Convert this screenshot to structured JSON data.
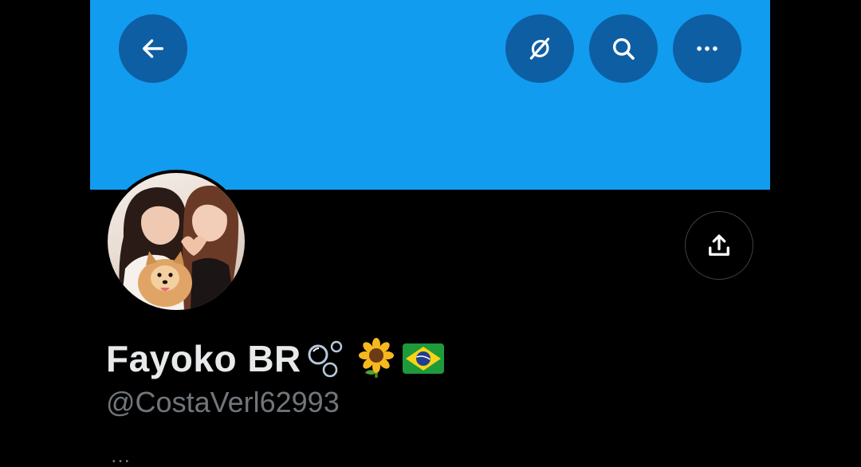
{
  "header": {
    "back_icon": "arrow-left-icon",
    "grok_icon": "grok-icon",
    "search_icon": "search-icon",
    "more_icon": "more-horizontal-icon"
  },
  "profile": {
    "display_name": "Fayoko BR",
    "emojis": [
      "bubbles-icon",
      "sunflower-icon",
      "brazil-flag-icon"
    ],
    "handle": "@CostaVerl62993",
    "share_icon": "share-icon",
    "cut_off_text": "…"
  },
  "colors": {
    "banner": "#119cf0",
    "header_buttons": "#0e5ea3",
    "background": "#000000",
    "name_text": "#e7e9ea",
    "handle_text": "#71767b"
  }
}
